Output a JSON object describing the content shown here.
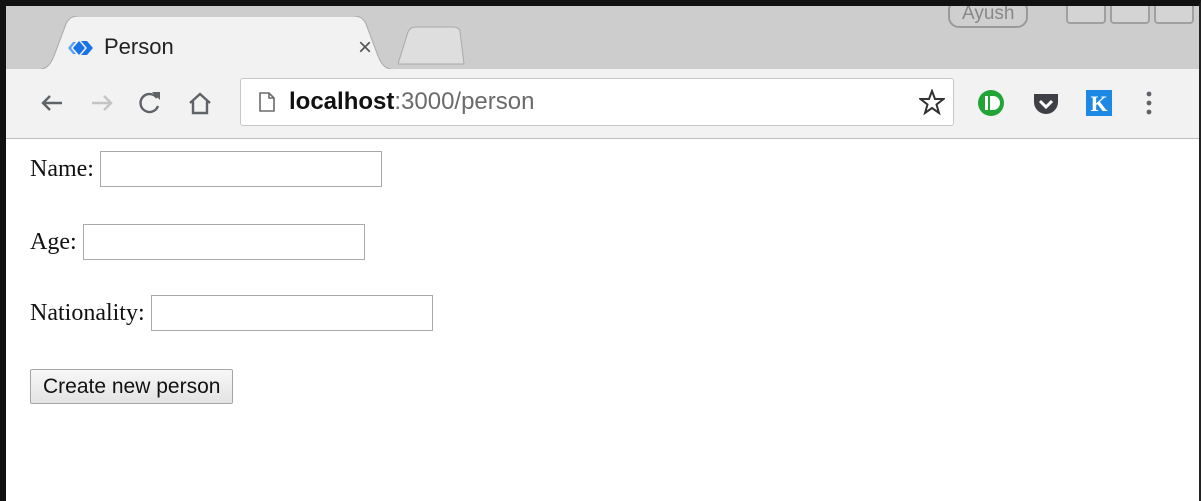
{
  "browser": {
    "profile_name": "Ayush",
    "tab": {
      "title": "Person",
      "close_glyph": "×",
      "favicon": "react-diamond-icon"
    },
    "toolbar": {
      "back_icon": "arrow-left-icon",
      "forward_icon": "arrow-right-icon",
      "reload_icon": "reload-icon",
      "home_icon": "home-icon",
      "url_host": "localhost",
      "url_path": ":3000/person",
      "bookmark_icon": "star-icon",
      "extensions": [
        "green-extension-icon",
        "pocket-icon",
        "k-extension-icon"
      ],
      "menu_icon": "kebab-menu-icon"
    },
    "colors": {
      "tab_strip": "#cdcdcd",
      "toolbar": "#f2f2f2",
      "accent_blue": "#1a73e8",
      "ext_green": "#23a437",
      "pocket": "#3f3f46"
    }
  },
  "form": {
    "name_label": "Name:",
    "name_value": "",
    "age_label": "Age:",
    "age_value": "",
    "nationality_label": "Nationality:",
    "nationality_value": "",
    "submit_label": "Create new person"
  }
}
